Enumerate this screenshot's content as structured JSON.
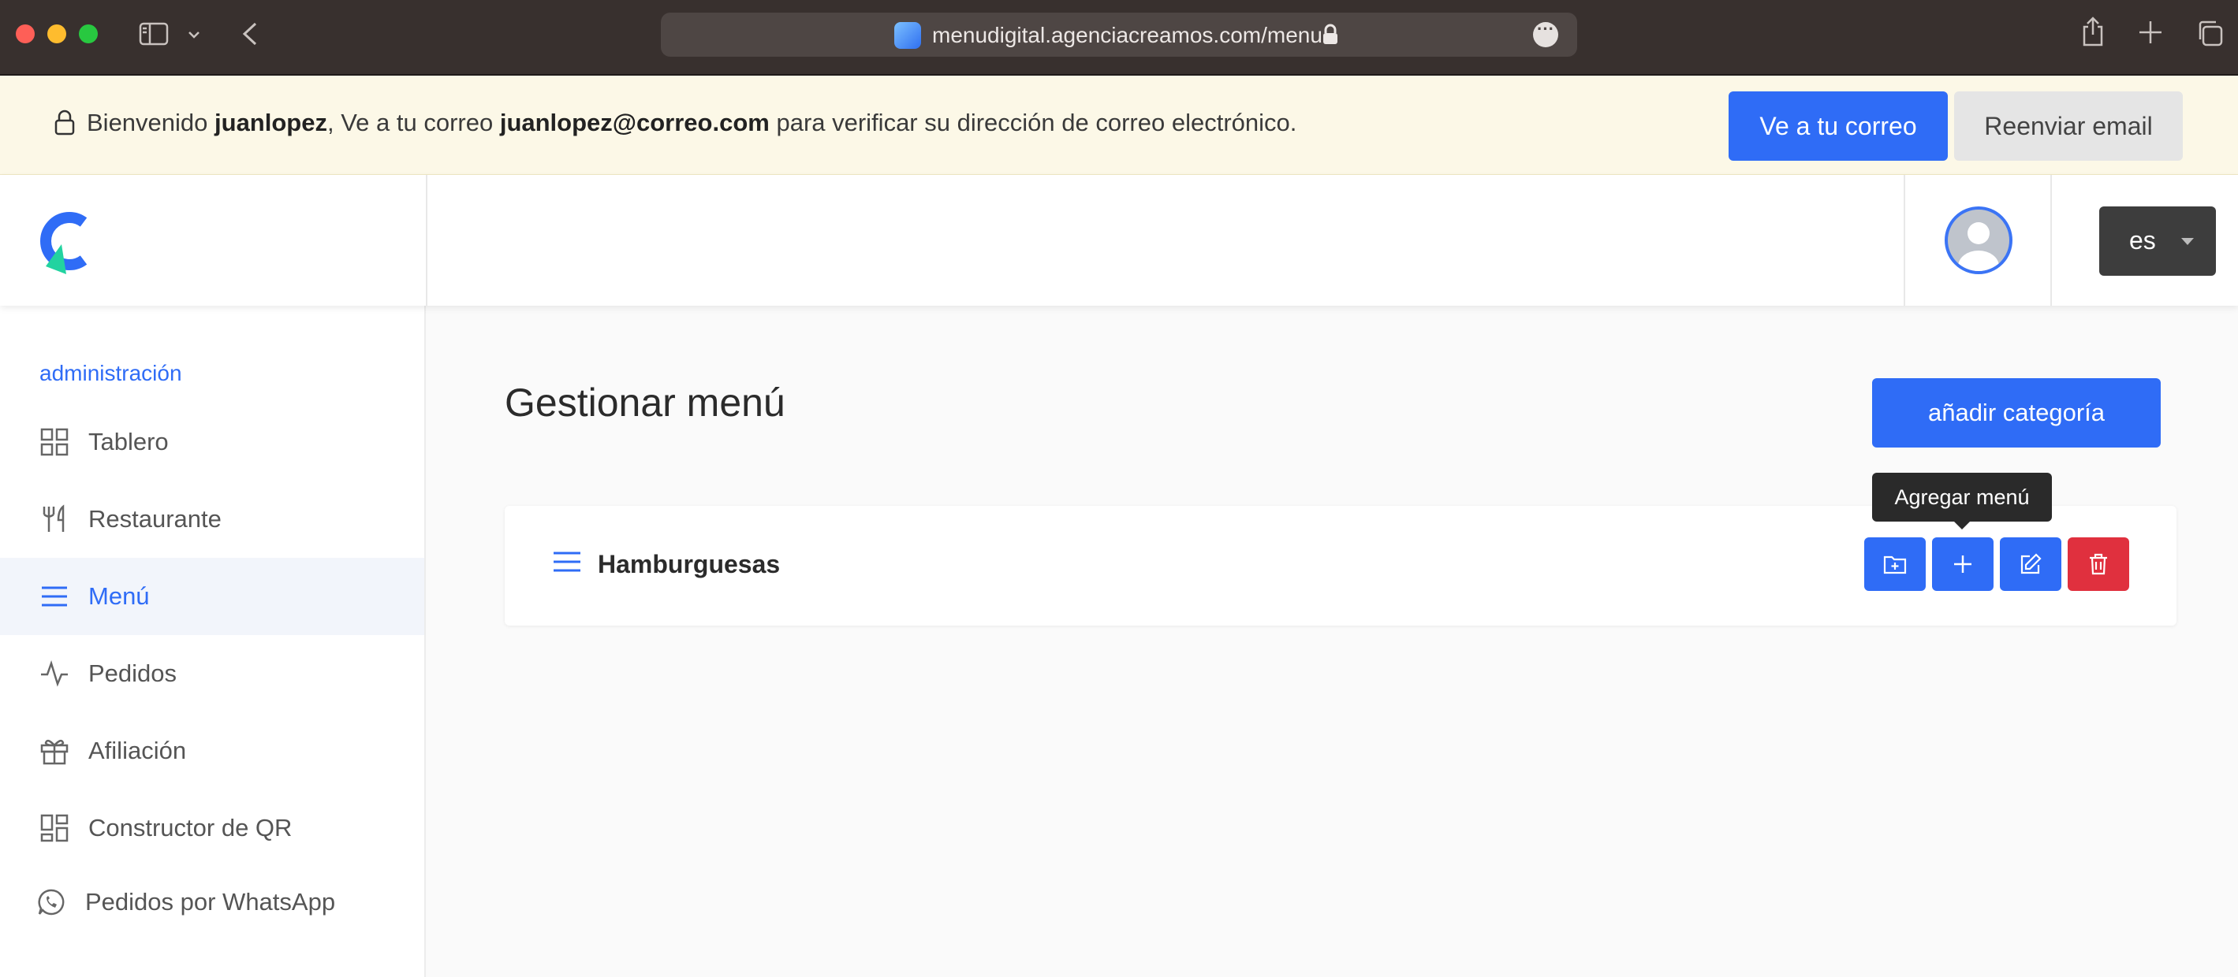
{
  "browser": {
    "url": "menudigital.agenciacreamos.com/menu"
  },
  "banner": {
    "prefix": "Bienvenido ",
    "username": "juanlopez",
    "middle": ", Ve a tu correo ",
    "email": "juanlopez@correo.com",
    "suffix": " para verificar su dirección de correo electrónico.",
    "go_to_mail_label": "Ve a tu correo",
    "resend_label": "Reenviar email"
  },
  "header": {
    "language": "es"
  },
  "sidebar": {
    "section_title": "administración",
    "items": [
      {
        "label": "Tablero",
        "icon": "grid-icon"
      },
      {
        "label": "Restaurante",
        "icon": "fork-knife-icon"
      },
      {
        "label": "Menú",
        "icon": "menu-lines-icon",
        "active": true
      },
      {
        "label": "Pedidos",
        "icon": "activity-icon"
      },
      {
        "label": "Afiliación",
        "icon": "gift-icon"
      },
      {
        "label": "Constructor de QR",
        "icon": "qr-grid-icon"
      },
      {
        "label": "Pedidos por WhatsApp",
        "icon": "whatsapp-icon"
      }
    ]
  },
  "main": {
    "title": "Gestionar menú",
    "add_category_label": "añadir categoría",
    "categories": [
      {
        "name": "Hamburguesas"
      }
    ],
    "tooltip": "Agregar menú"
  },
  "colors": {
    "primary": "#2f6cf6",
    "danger": "#e0303e",
    "banner_bg": "#fcf8e7"
  }
}
